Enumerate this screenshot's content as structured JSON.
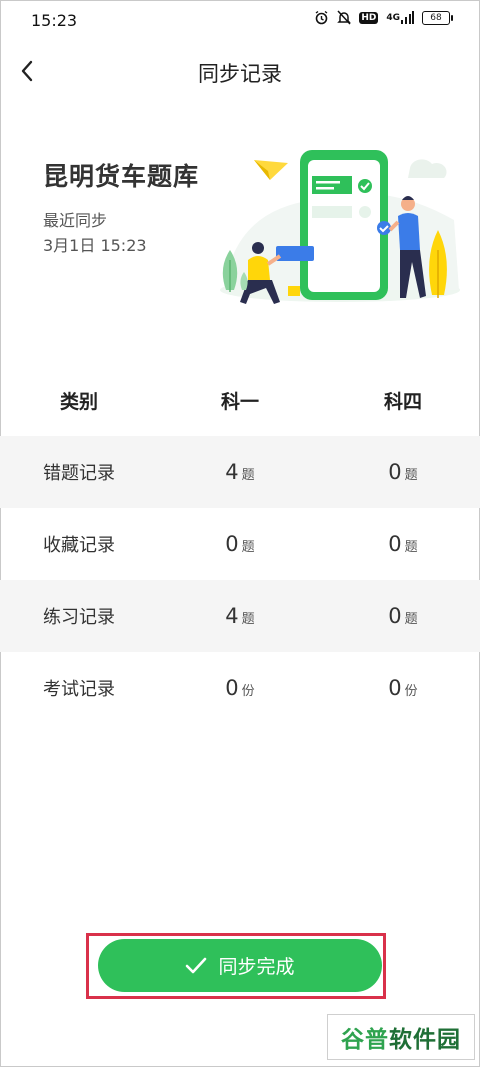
{
  "status_bar": {
    "time": "15:23",
    "hd": "HD",
    "network": "4G",
    "battery": "68"
  },
  "nav": {
    "title": "同步记录"
  },
  "header": {
    "bank_name": "昆明货车题库",
    "sync_label": "最近同步",
    "sync_time": "3月1日 15:23"
  },
  "table": {
    "columns": [
      "类别",
      "科一",
      "科四"
    ],
    "rows": [
      {
        "label": "错题记录",
        "k1": "4",
        "k4": "0",
        "unit": "题"
      },
      {
        "label": "收藏记录",
        "k1": "0",
        "k4": "0",
        "unit": "题"
      },
      {
        "label": "练习记录",
        "k1": "4",
        "k4": "0",
        "unit": "题"
      },
      {
        "label": "考试记录",
        "k1": "0",
        "k4": "0",
        "unit": "份"
      }
    ]
  },
  "footer": {
    "button_label": "同步完成"
  },
  "watermark": {
    "part1": "谷普",
    "part2": "软件园"
  },
  "colors": {
    "accent": "#2fc05a",
    "highlight": "#d9314a",
    "row_shade": "#f5f5f5"
  },
  "icons": {
    "back": "chevron-left-icon",
    "check": "checkmark-icon",
    "alarm": "alarm-icon",
    "mute": "bell-off-icon",
    "signal": "signal-icon"
  }
}
